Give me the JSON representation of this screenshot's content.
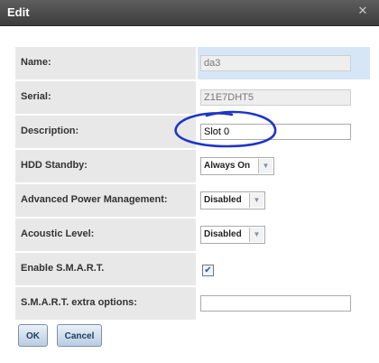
{
  "dialog": {
    "title": "Edit",
    "close_glyph": "✕"
  },
  "fields": [
    {
      "label": "Name:",
      "value": "da3"
    },
    {
      "label": "Serial:",
      "value": "Z1E7DHT5"
    },
    {
      "label": "Description:",
      "value": "Slot 0"
    },
    {
      "label": "HDD Standby:",
      "value": "Always On"
    },
    {
      "label": "Advanced Power Management:",
      "value": "Disabled"
    },
    {
      "label": "Acoustic Level:",
      "value": "Disabled"
    },
    {
      "label": "Enable S.M.A.R.T.",
      "checked": true,
      "check_glyph": "✔"
    },
    {
      "label": "S.M.A.R.T. extra options:",
      "value": ""
    }
  ],
  "buttons": {
    "ok": "OK",
    "cancel": "Cancel"
  },
  "icons": {
    "close": "close-icon",
    "dropdown": "chevron-down-icon",
    "check": "check-icon"
  },
  "colors": {
    "titlebar": "#4a4a4a",
    "label_bg": "#e8e8e8",
    "highlight": "#d6e6f7",
    "annotation": "#1f35c8"
  }
}
